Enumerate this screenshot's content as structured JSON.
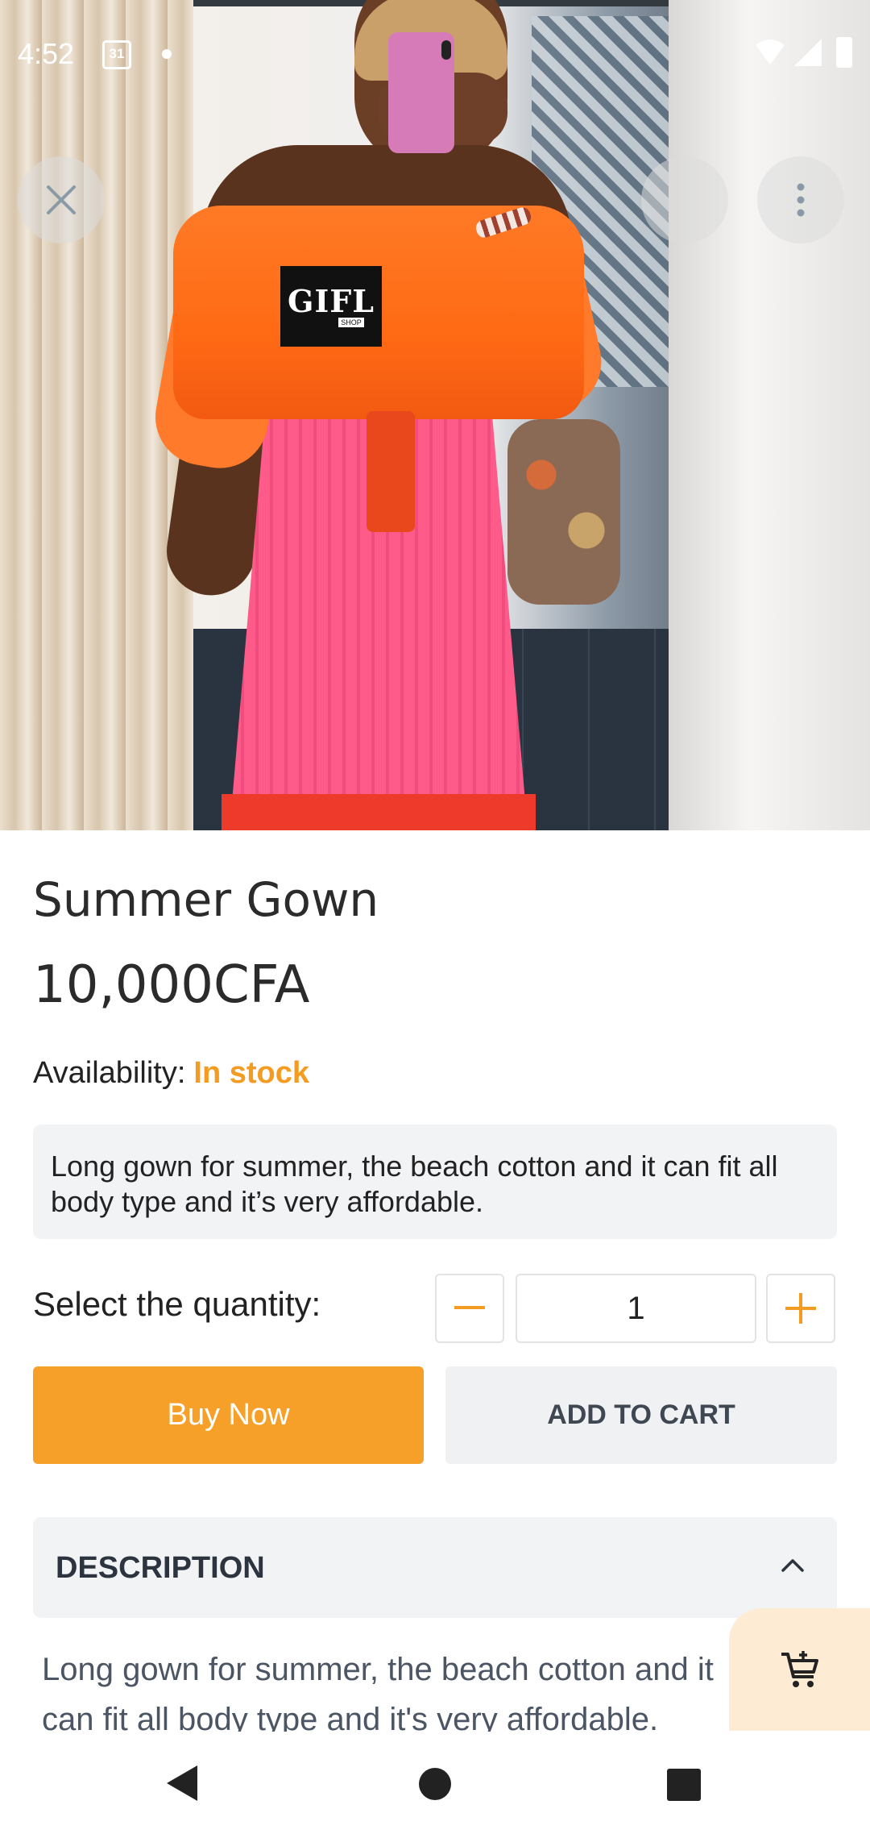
{
  "status_bar": {
    "time": "4:52",
    "calendar_day": "31"
  },
  "hero": {
    "brand_badge_text": "GIFL",
    "brand_badge_subtext": "SHOP"
  },
  "product": {
    "title": "Summer Gown",
    "price": "10,000CFA",
    "availability_label": "Availability:",
    "availability_value": "In stock",
    "short_description": "Long gown for summer, the beach cotton and it can fit all body type and it’s very affordable."
  },
  "quantity": {
    "label": "Select the quantity:",
    "value": "1"
  },
  "actions": {
    "buy_now": "Buy Now",
    "add_to_cart": "ADD TO CART"
  },
  "description_section": {
    "heading": "DESCRIPTION",
    "body": "Long gown for summer, the beach cotton and it can fit all body type and it's very affordable."
  },
  "colors": {
    "accent": "#f6a029",
    "in_stock": "#f39c21",
    "panel_bg": "#f2f3f5",
    "fab_bg": "#fdecd3"
  },
  "icons": {
    "close": "close-icon",
    "share": "share-icon",
    "more": "more-vertical-icon",
    "minus": "minus-icon",
    "plus": "plus-icon",
    "chevron": "chevron-up-icon",
    "cart": "cart-add-icon",
    "back": "back-triangle-icon",
    "home": "home-circle-icon",
    "recents": "recents-square-icon"
  }
}
